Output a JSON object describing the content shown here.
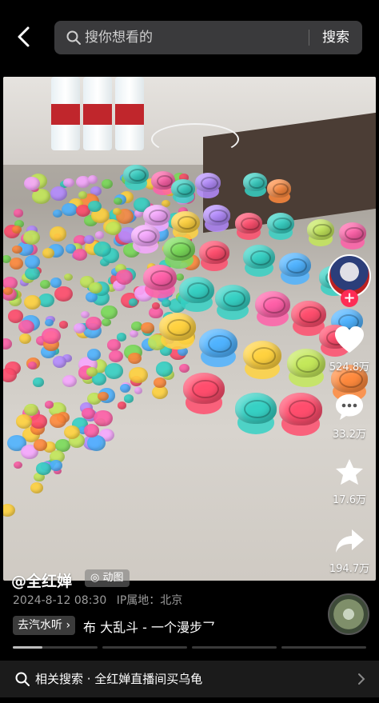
{
  "header": {
    "search_placeholder": "搜你想看的",
    "search_button": "搜索"
  },
  "actions": {
    "like_count": "524.8万",
    "comment_count": "33.2万",
    "favorite_count": "17.6万",
    "share_count": "194.7万"
  },
  "post": {
    "author": "@全红婵",
    "tag": "动图",
    "date": "2024-8-12 08:30",
    "location_label": "IP属地：北京",
    "music_tag": "去汽水听",
    "music_title": "布 大乱斗 - 一个漫步乛"
  },
  "progress": {
    "segments": 4,
    "current_fraction": 0.35
  },
  "related": {
    "text": "相关搜索 · 全红婵直播间买乌龟"
  },
  "colors": {
    "accent": "#fe2c55",
    "background": "#000000"
  }
}
